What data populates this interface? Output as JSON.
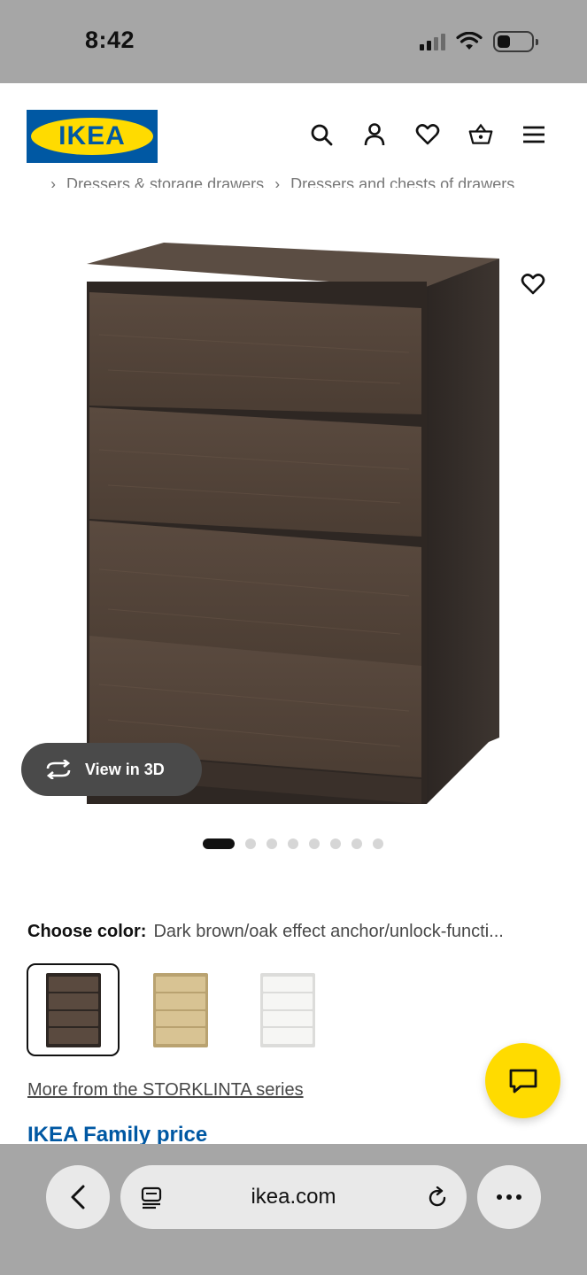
{
  "status_bar": {
    "time": "8:42"
  },
  "header": {
    "logo_text": "IKEA",
    "icons": [
      "search-icon",
      "account-icon",
      "heart-icon",
      "basket-icon",
      "menu-icon"
    ]
  },
  "breadcrumb": {
    "items": [
      "...",
      "Dressers & storage drawers",
      "Dressers and chests of drawers"
    ]
  },
  "product": {
    "view_3d_label": "View in 3D",
    "carousel": {
      "total": 8,
      "active_index": 0
    }
  },
  "color": {
    "label": "Choose color:",
    "value": "Dark brown/oak effect anchor/unlock-functi...",
    "swatches": [
      {
        "name": "dark-brown",
        "color": "#4a3d33",
        "selected": true
      },
      {
        "name": "oak-effect",
        "color": "#d6c08f",
        "selected": false
      },
      {
        "name": "white",
        "color": "#f4f4f2",
        "selected": false
      }
    ]
  },
  "series_link": "More from the STORKLINTA series",
  "family_price": "IKEA Family price",
  "browser": {
    "url": "ikea.com"
  },
  "colors": {
    "ikea_blue": "#0058a3",
    "ikea_yellow": "#ffdb00",
    "bar_gray": "#a6a6a6"
  }
}
